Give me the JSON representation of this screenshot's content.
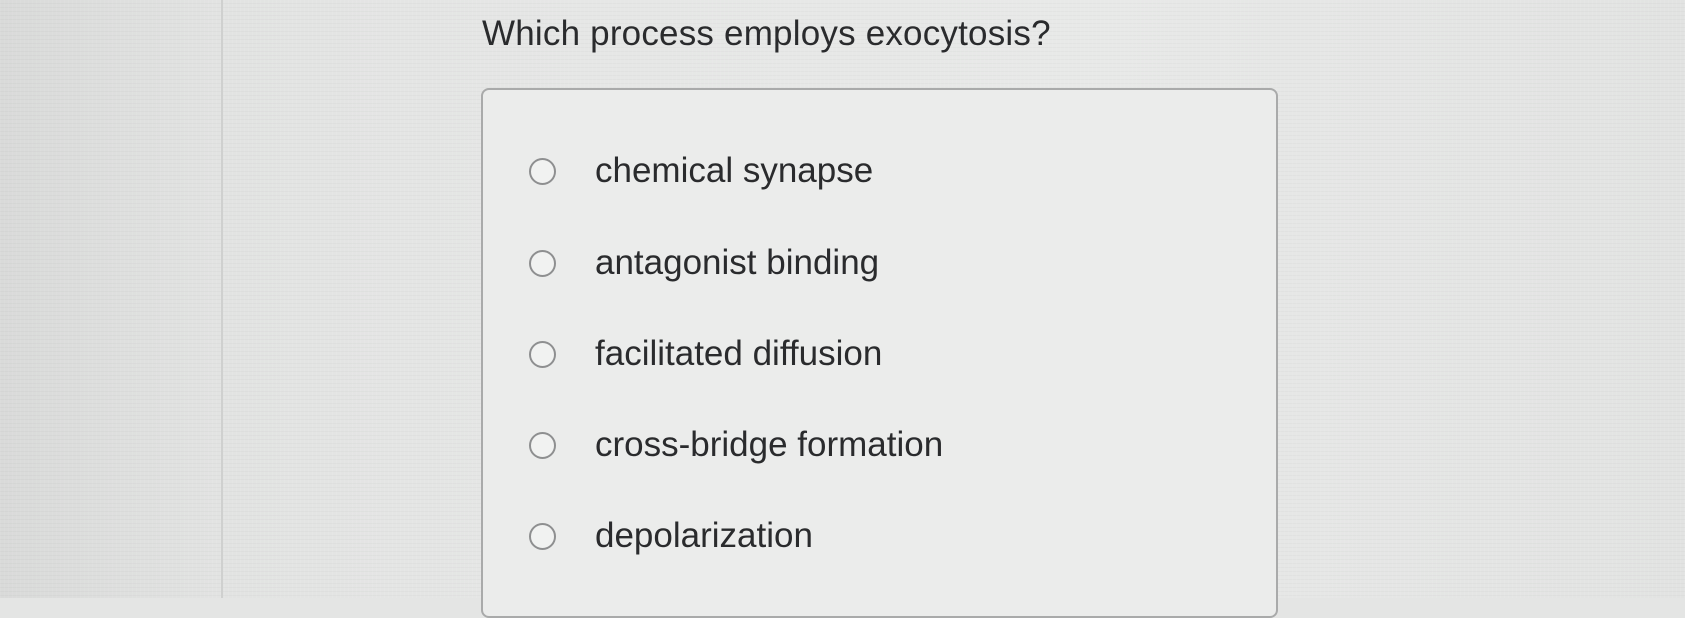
{
  "question": {
    "text": "Which process employs exocytosis?"
  },
  "options": [
    {
      "label": "chemical synapse",
      "selected": false
    },
    {
      "label": "antagonist binding",
      "selected": false
    },
    {
      "label": "facilitated diffusion",
      "selected": false
    },
    {
      "label": "cross-bridge formation",
      "selected": false
    },
    {
      "label": "depolarization",
      "selected": false
    }
  ],
  "colors": {
    "background": "#e4e5e4",
    "text": "#2a2b2d",
    "box_border": "#a9aaaa",
    "radio_border": "#8e8f90"
  }
}
